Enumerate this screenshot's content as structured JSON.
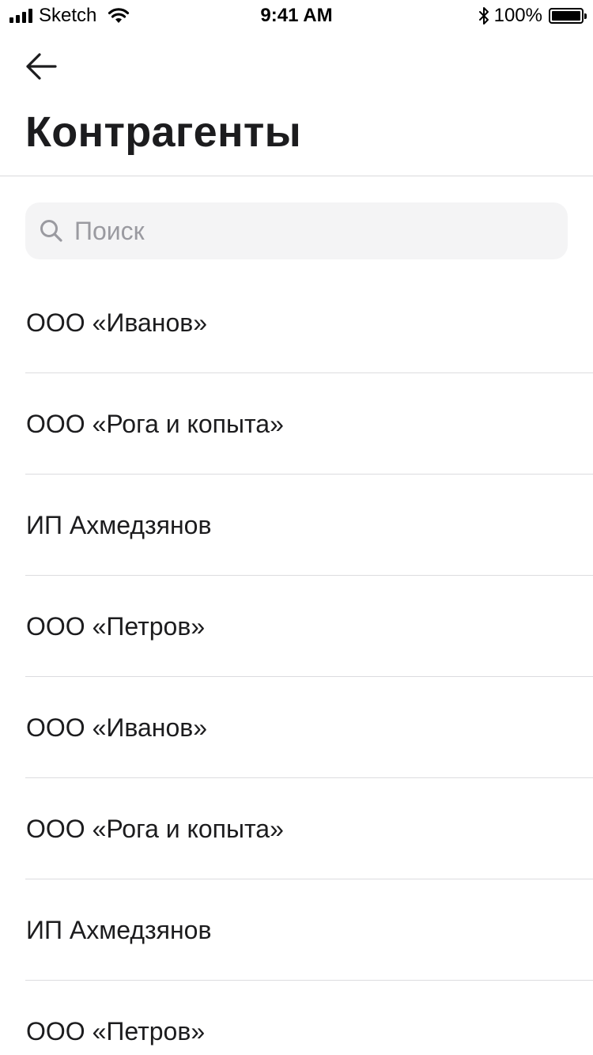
{
  "status_bar": {
    "carrier": "Sketch",
    "time": "9:41 AM",
    "battery_percent": "100%",
    "battery_level": 1.0,
    "icons": [
      "signal-icon",
      "wifi-icon",
      "bluetooth-icon",
      "battery-icon"
    ]
  },
  "header": {
    "back_icon": "arrow-left-icon",
    "title": "Контрагенты"
  },
  "search": {
    "icon": "search-icon",
    "placeholder": "Поиск",
    "value": ""
  },
  "contractors": [
    {
      "label": "ООО «Иванов»"
    },
    {
      "label": "ООО «Рога и копыта»"
    },
    {
      "label": "ИП Ахмедзянов"
    },
    {
      "label": "ООО «Петров»"
    },
    {
      "label": "ООО «Иванов»"
    },
    {
      "label": "ООО «Рога и копыта»"
    },
    {
      "label": "ИП Ахмедзянов"
    },
    {
      "label": "ООО «Петров»"
    }
  ],
  "colors": {
    "text": "#1c1c1e",
    "placeholder": "#9a9aa0",
    "search_bg": "#f4f4f5",
    "divider": "#dcdcdf",
    "background": "#ffffff"
  }
}
